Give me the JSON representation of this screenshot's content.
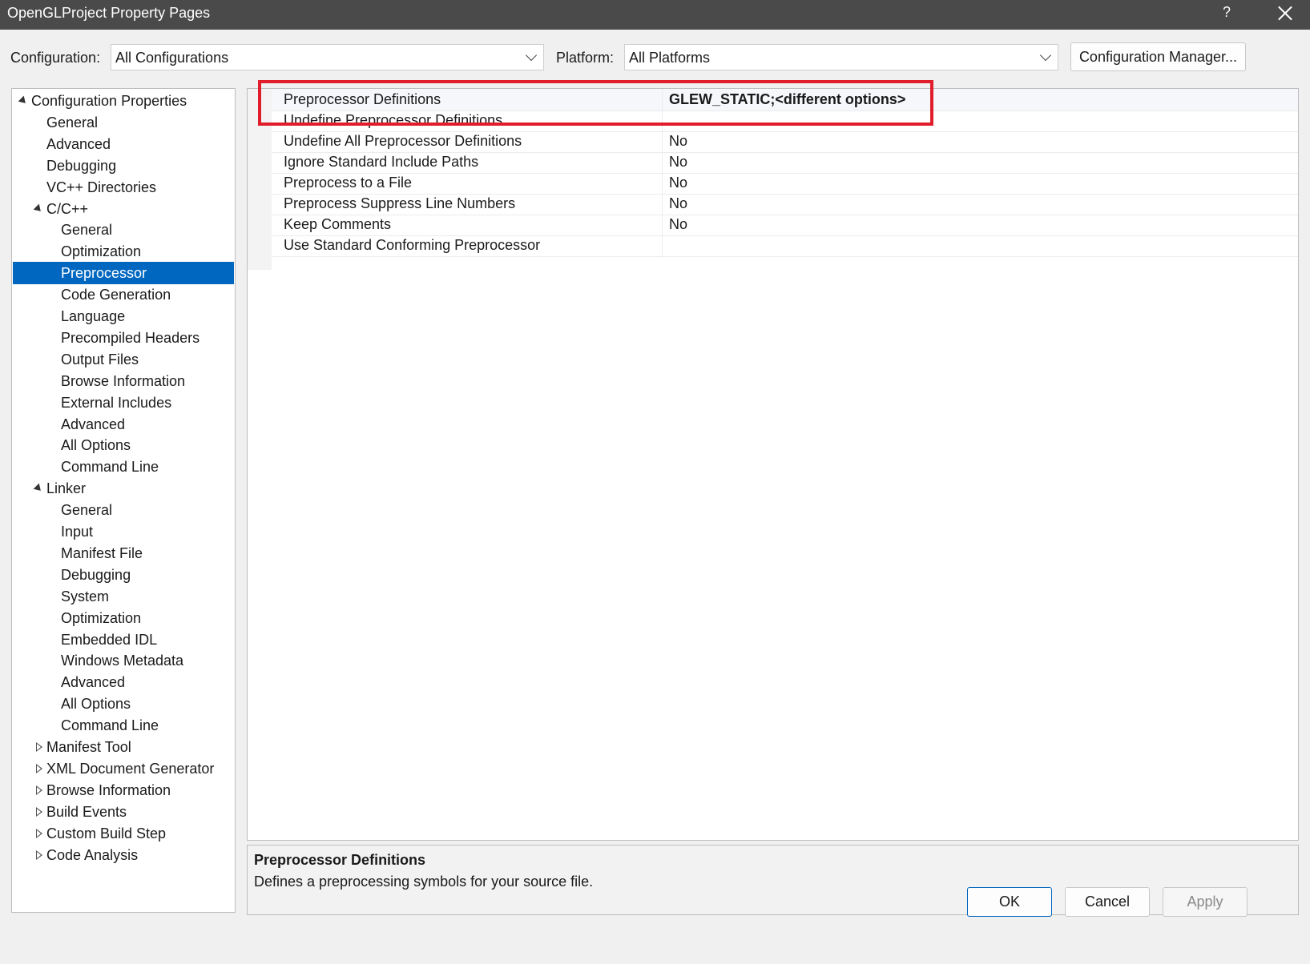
{
  "window": {
    "title": "OpenGLProject Property Pages",
    "help_label": "?"
  },
  "config": {
    "configuration_label": "Configuration:",
    "configuration_value": "All Configurations",
    "platform_label": "Platform:",
    "platform_value": "All Platforms",
    "manager_button": "Configuration Manager..."
  },
  "tree": [
    {
      "label": "Configuration Properties",
      "level": 0,
      "expander": "expanded"
    },
    {
      "label": "General",
      "level": 1,
      "expander": "none"
    },
    {
      "label": "Advanced",
      "level": 1,
      "expander": "none"
    },
    {
      "label": "Debugging",
      "level": 1,
      "expander": "none"
    },
    {
      "label": "VC++ Directories",
      "level": 1,
      "expander": "none"
    },
    {
      "label": "C/C++",
      "level": 1,
      "expander": "expanded"
    },
    {
      "label": "General",
      "level": 2,
      "expander": "none"
    },
    {
      "label": "Optimization",
      "level": 2,
      "expander": "none"
    },
    {
      "label": "Preprocessor",
      "level": 2,
      "expander": "none",
      "selected": true
    },
    {
      "label": "Code Generation",
      "level": 2,
      "expander": "none"
    },
    {
      "label": "Language",
      "level": 2,
      "expander": "none"
    },
    {
      "label": "Precompiled Headers",
      "level": 2,
      "expander": "none"
    },
    {
      "label": "Output Files",
      "level": 2,
      "expander": "none"
    },
    {
      "label": "Browse Information",
      "level": 2,
      "expander": "none"
    },
    {
      "label": "External Includes",
      "level": 2,
      "expander": "none"
    },
    {
      "label": "Advanced",
      "level": 2,
      "expander": "none"
    },
    {
      "label": "All Options",
      "level": 2,
      "expander": "none"
    },
    {
      "label": "Command Line",
      "level": 2,
      "expander": "none"
    },
    {
      "label": "Linker",
      "level": 1,
      "expander": "expanded"
    },
    {
      "label": "General",
      "level": 2,
      "expander": "none"
    },
    {
      "label": "Input",
      "level": 2,
      "expander": "none"
    },
    {
      "label": "Manifest File",
      "level": 2,
      "expander": "none"
    },
    {
      "label": "Debugging",
      "level": 2,
      "expander": "none"
    },
    {
      "label": "System",
      "level": 2,
      "expander": "none"
    },
    {
      "label": "Optimization",
      "level": 2,
      "expander": "none"
    },
    {
      "label": "Embedded IDL",
      "level": 2,
      "expander": "none"
    },
    {
      "label": "Windows Metadata",
      "level": 2,
      "expander": "none"
    },
    {
      "label": "Advanced",
      "level": 2,
      "expander": "none"
    },
    {
      "label": "All Options",
      "level": 2,
      "expander": "none"
    },
    {
      "label": "Command Line",
      "level": 2,
      "expander": "none"
    },
    {
      "label": "Manifest Tool",
      "level": 1,
      "expander": "collapsed"
    },
    {
      "label": "XML Document Generator",
      "level": 1,
      "expander": "collapsed"
    },
    {
      "label": "Browse Information",
      "level": 1,
      "expander": "collapsed"
    },
    {
      "label": "Build Events",
      "level": 1,
      "expander": "collapsed"
    },
    {
      "label": "Custom Build Step",
      "level": 1,
      "expander": "collapsed"
    },
    {
      "label": "Code Analysis",
      "level": 1,
      "expander": "collapsed"
    }
  ],
  "properties": [
    {
      "name": "Preprocessor Definitions",
      "value": "GLEW_STATIC;<different options>",
      "highlighted": true
    },
    {
      "name": "Undefine Preprocessor Definitions",
      "value": ""
    },
    {
      "name": "Undefine All Preprocessor Definitions",
      "value": "No"
    },
    {
      "name": "Ignore Standard Include Paths",
      "value": "No"
    },
    {
      "name": "Preprocess to a File",
      "value": "No"
    },
    {
      "name": "Preprocess Suppress Line Numbers",
      "value": "No"
    },
    {
      "name": "Keep Comments",
      "value": "No"
    },
    {
      "name": "Use Standard Conforming Preprocessor",
      "value": ""
    }
  ],
  "description": {
    "title": "Preprocessor Definitions",
    "text": "Defines a preprocessing symbols for your source file."
  },
  "buttons": {
    "ok": "OK",
    "cancel": "Cancel",
    "apply": "Apply"
  },
  "colors": {
    "titlebar": "#4a4a4a",
    "selection": "#0067c0",
    "highlight_box": "#e01e2b"
  }
}
